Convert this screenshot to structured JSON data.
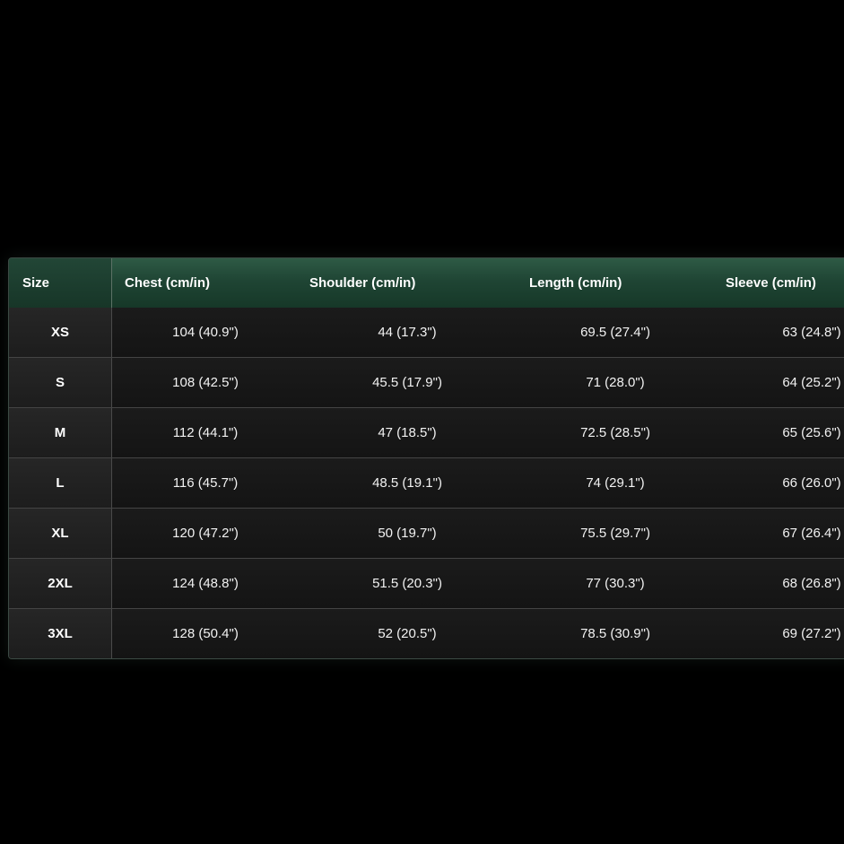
{
  "table": {
    "headers": [
      "Size",
      "Chest (cm/in)",
      "Shoulder (cm/in)",
      "Length (cm/in)",
      "Sleeve (cm/in)"
    ],
    "rows": [
      {
        "size": "XS",
        "chest": "104 (40.9\")",
        "shoulder": "44 (17.3\")",
        "length": "69.5 (27.4\")",
        "sleeve": "63 (24.8\")"
      },
      {
        "size": "S",
        "chest": "108 (42.5\")",
        "shoulder": "45.5 (17.9\")",
        "length": "71 (28.0\")",
        "sleeve": "64 (25.2\")"
      },
      {
        "size": "M",
        "chest": "112 (44.1\")",
        "shoulder": "47 (18.5\")",
        "length": "72.5 (28.5\")",
        "sleeve": "65 (25.6\")"
      },
      {
        "size": "L",
        "chest": "116 (45.7\")",
        "shoulder": "48.5 (19.1\")",
        "length": "74 (29.1\")",
        "sleeve": "66 (26.0\")"
      },
      {
        "size": "XL",
        "chest": "120 (47.2\")",
        "shoulder": "50 (19.7\")",
        "length": "75.5 (29.7\")",
        "sleeve": "67 (26.4\")"
      },
      {
        "size": "2XL",
        "chest": "124 (48.8\")",
        "shoulder": "51.5 (20.3\")",
        "length": "77 (30.3\")",
        "sleeve": "68 (26.8\")"
      },
      {
        "size": "3XL",
        "chest": "128 (50.4\")",
        "shoulder": "52 (20.5\")",
        "length": "78.5 (30.9\")",
        "sleeve": "69 (27.2\")"
      }
    ]
  },
  "colors": {
    "background": "#000000",
    "header_green": "#1f4534",
    "row_dark": "#161616",
    "text": "#ffffff"
  }
}
